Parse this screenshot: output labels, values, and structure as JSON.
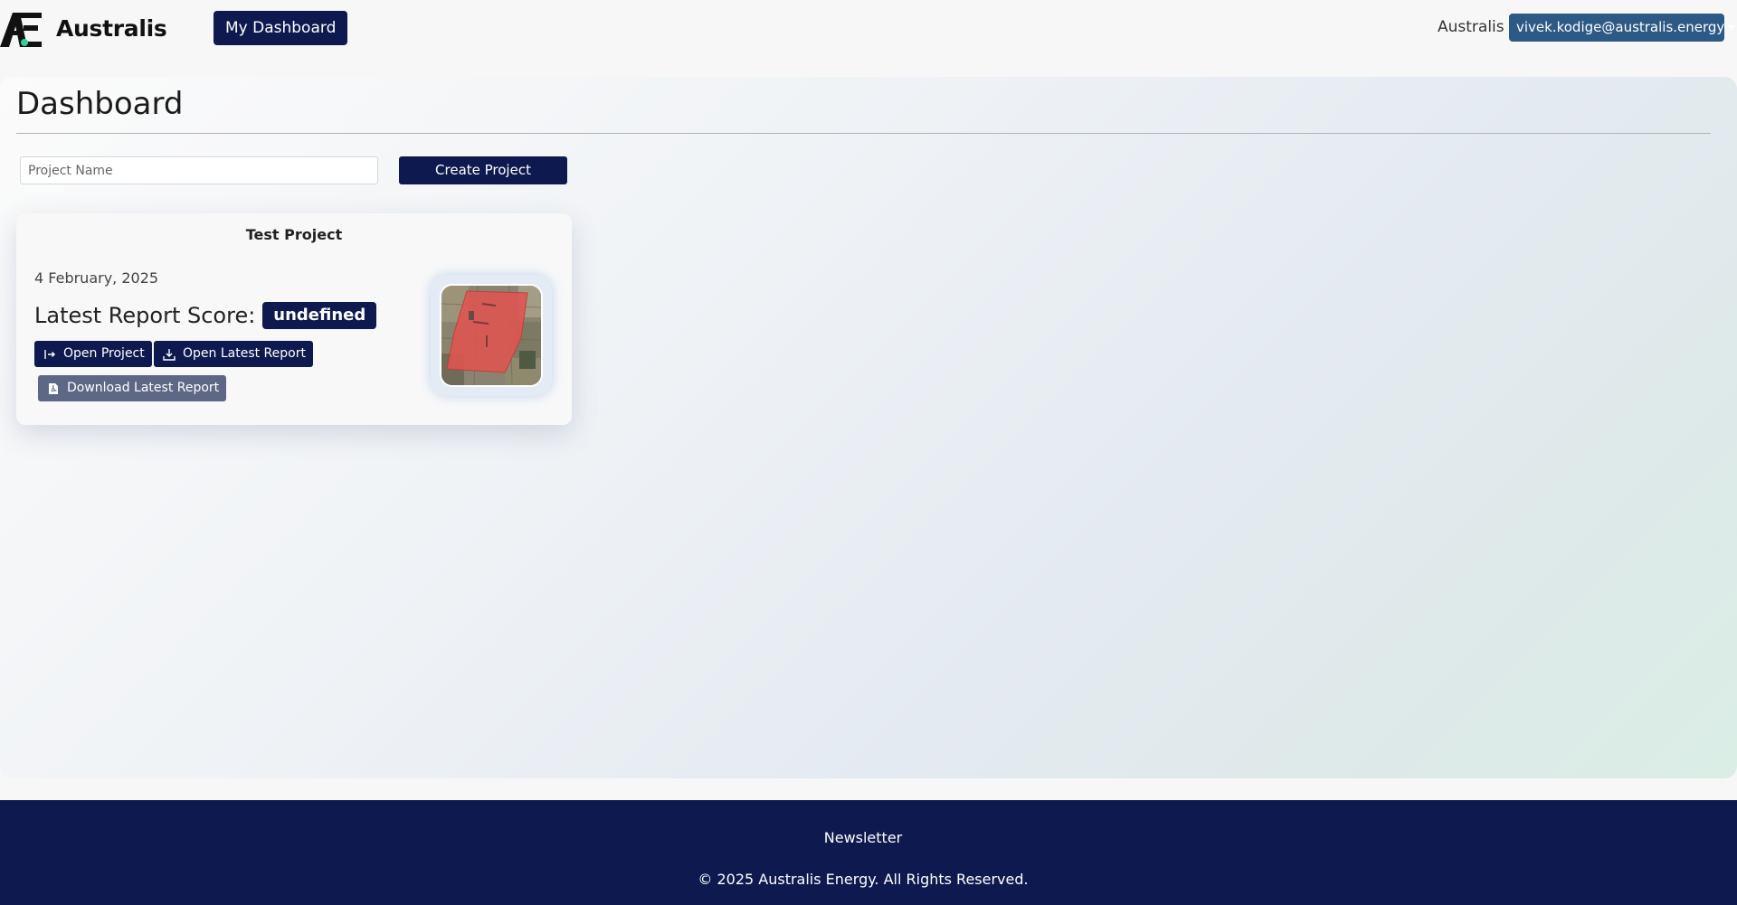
{
  "navbar": {
    "brand_name": "Australis",
    "dashboard_label": "My Dashboard",
    "region_label": "Australis",
    "user_email": "vivek.kodige@australis.energy"
  },
  "main": {
    "title": "Dashboard",
    "project_input_placeholder": "Project Name",
    "create_button_label": "Create Project"
  },
  "project_card": {
    "title": "Test Project",
    "date": "4 February, 2025",
    "score_label": "Latest Report Score:",
    "score_value": "undefined",
    "open_project_label": "Open Project",
    "open_report_label": "Open Latest Report",
    "download_report_label": "Download Latest Report"
  },
  "footer": {
    "newsletter_label": "Newsletter",
    "copyright": "© 2025 Australis Energy. All Rights Reserved."
  },
  "colors": {
    "primary": "#0e1a4f",
    "user_button": "#2c5985",
    "muted_button": "#5d6887",
    "brand_accent": "#2fd19a"
  }
}
